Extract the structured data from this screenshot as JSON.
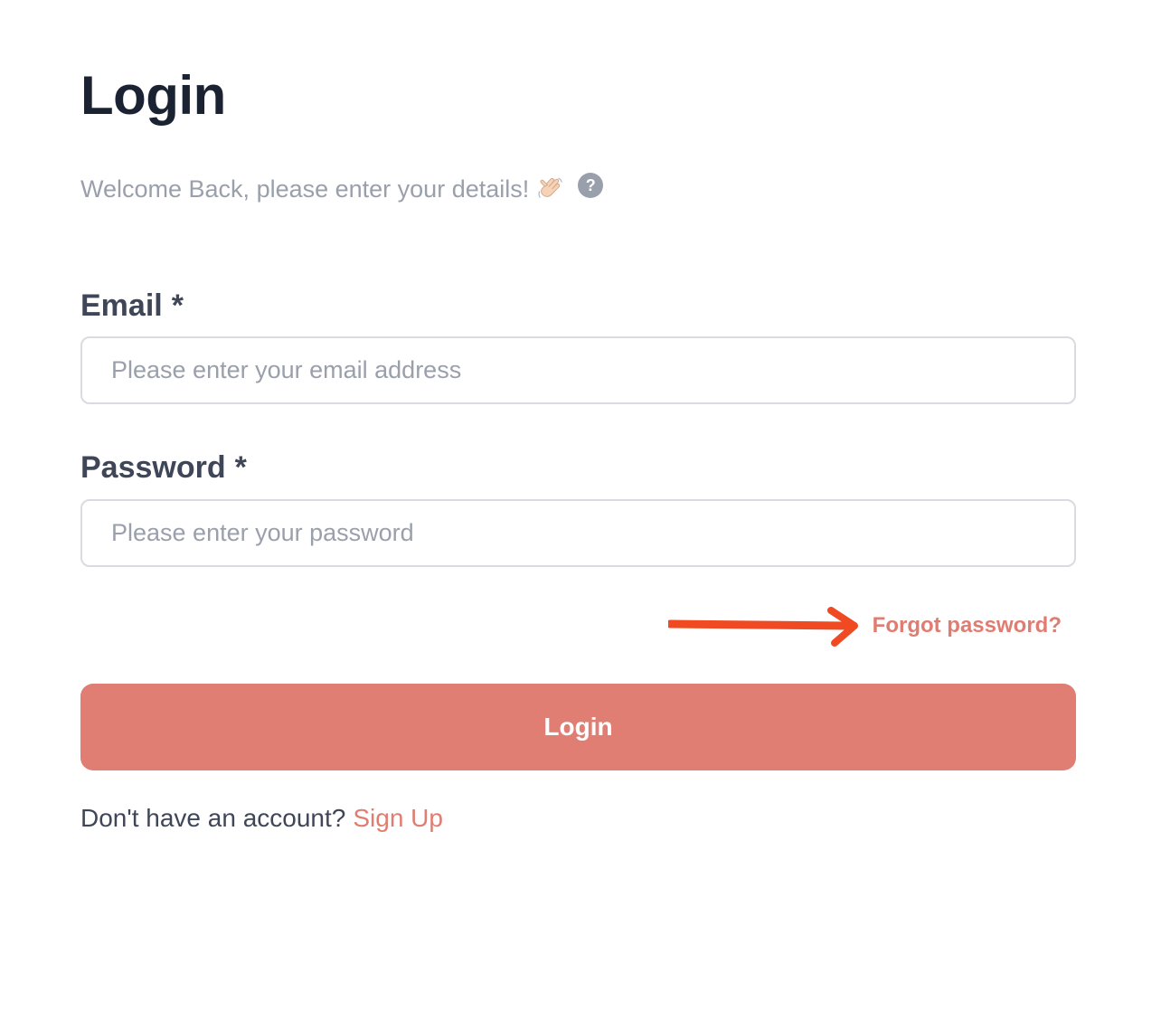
{
  "page_title": "Login",
  "welcome": {
    "text": "Welcome Back, please enter your details!",
    "emoji": "👋",
    "help_icon": "question-circle-icon",
    "help_glyph": "?"
  },
  "email": {
    "label": "Email",
    "required_marker": "*",
    "placeholder": "Please enter your email address",
    "value": ""
  },
  "password": {
    "label": "Password",
    "required_marker": "*",
    "placeholder": "Please enter your password",
    "value": ""
  },
  "forgot_password": {
    "label": "Forgot password?",
    "annotation": "arrow-right-icon"
  },
  "login_button": {
    "label": "Login"
  },
  "signup": {
    "prompt": "Don't have an account?",
    "link_label": "Sign Up"
  },
  "colors": {
    "accent": "#e17e74",
    "link": "#e07d72",
    "annotation_arrow": "#f04a23",
    "heading": "#1b2333",
    "label": "#3f4657",
    "muted": "#9aa0ab",
    "input_border": "#d9dbe0"
  }
}
